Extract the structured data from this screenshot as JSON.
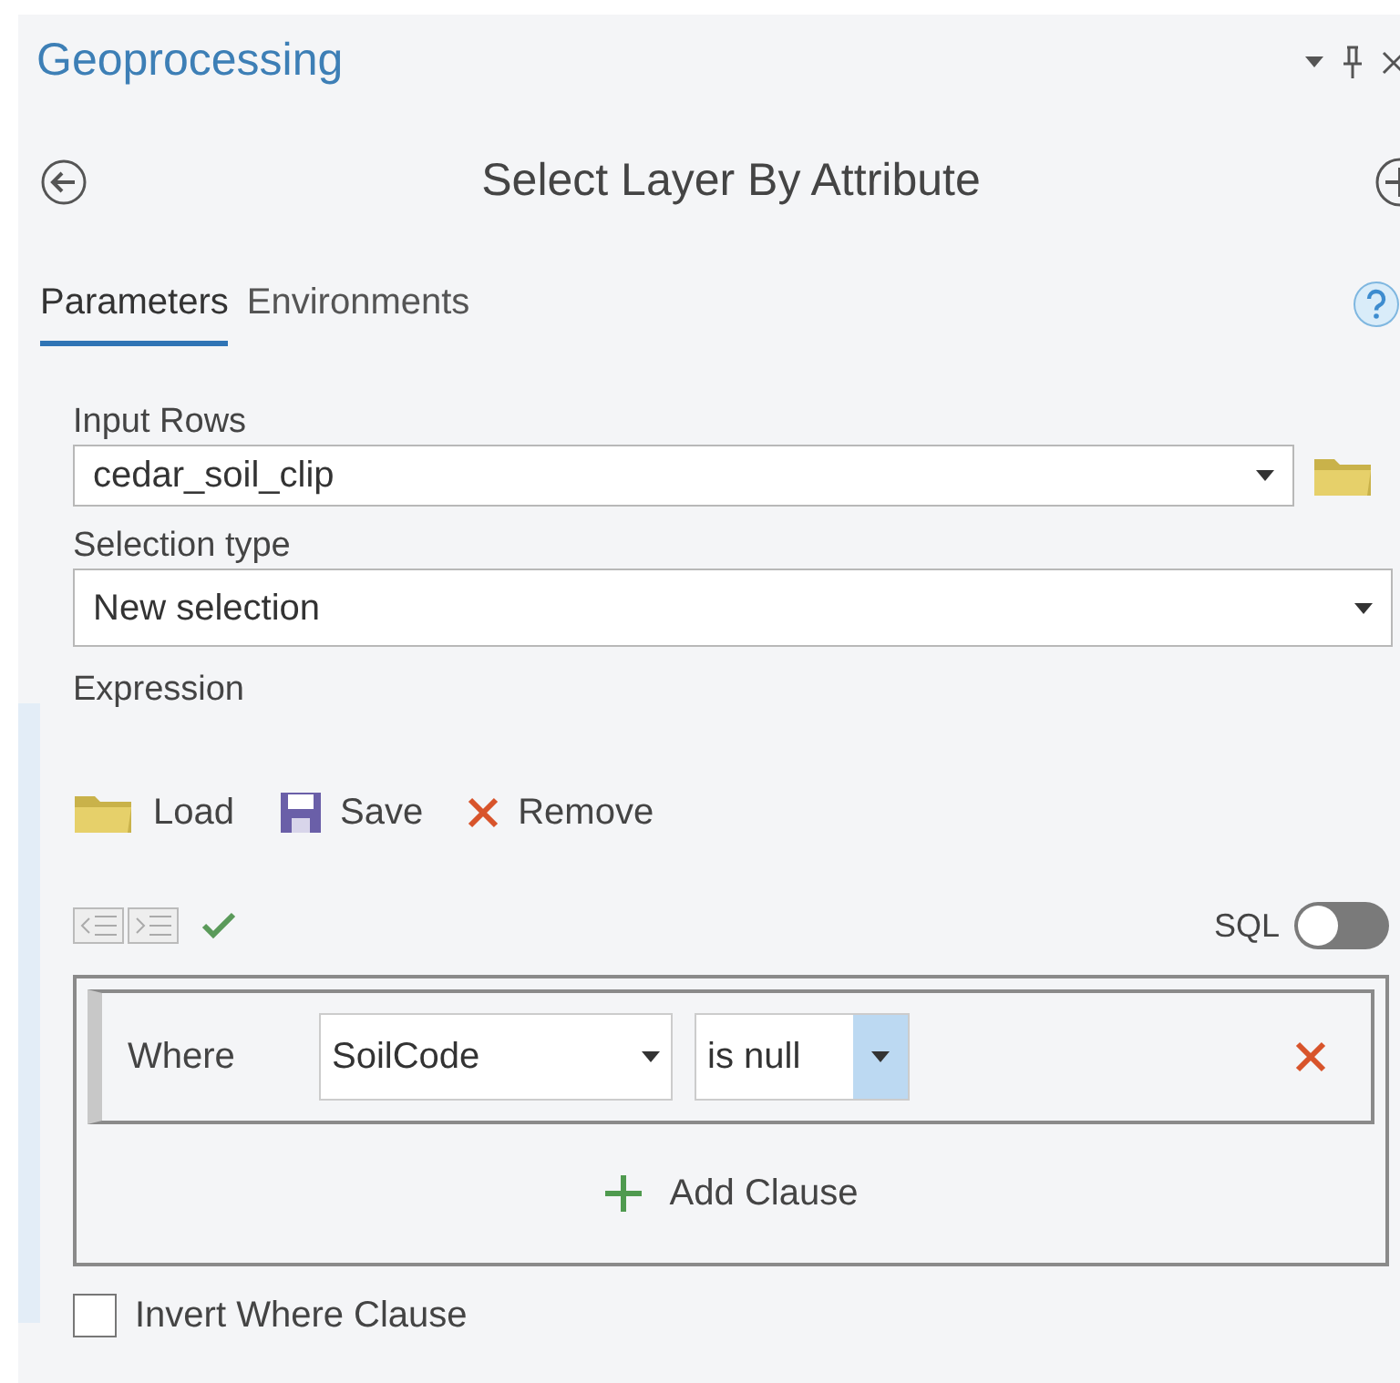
{
  "window": {
    "title": "Geoprocessing"
  },
  "tool": {
    "title": "Select Layer By Attribute"
  },
  "tabs": [
    {
      "label": "Parameters",
      "selected": true
    },
    {
      "label": "Environments",
      "selected": false
    }
  ],
  "parameters": {
    "input_rows": {
      "label": "Input Rows",
      "value": "cedar_soil_clip"
    },
    "selection_type": {
      "label": "Selection type",
      "value": "New selection"
    },
    "expression": {
      "label": "Expression",
      "actions": [
        {
          "kind": "load",
          "label": "Load"
        },
        {
          "kind": "save",
          "label": "Save"
        },
        {
          "kind": "remove",
          "label": "Remove"
        }
      ],
      "sql": {
        "label": "SQL",
        "on": false
      },
      "clauses": [
        {
          "connector": "Where",
          "field": "SoilCode",
          "operator": "is null"
        }
      ],
      "add_clause": "Add Clause"
    },
    "invert_where_clause": {
      "label": "Invert Where Clause",
      "checked": false
    }
  }
}
